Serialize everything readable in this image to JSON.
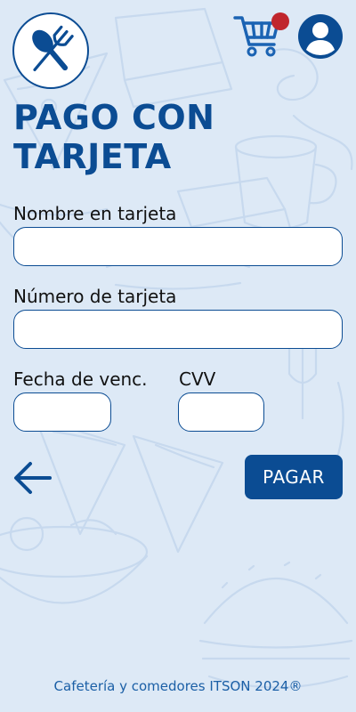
{
  "header": {
    "logo_icon": "spoon-fork-icon",
    "cart_icon": "shopping-cart-icon",
    "cart_badge_color": "#c0262d",
    "profile_icon": "user-avatar-icon"
  },
  "page": {
    "title_line1": "PAGO CON",
    "title_line2": "TARJETA"
  },
  "form": {
    "name_label": "Nombre en tarjeta",
    "name_value": "",
    "number_label": "Número de tarjeta",
    "number_value": "",
    "expiry_label": "Fecha de venc.",
    "expiry_value": "",
    "cvv_label": "CVV",
    "cvv_value": ""
  },
  "actions": {
    "back_icon": "arrow-left-icon",
    "pay_label": "PAGAR"
  },
  "footer": {
    "text": "Cafetería y comedores ITSON 2024®"
  },
  "colors": {
    "primary": "#0b4c93",
    "background": "#dde9f6",
    "badge": "#c0262d",
    "field_background": "#ffffff"
  }
}
